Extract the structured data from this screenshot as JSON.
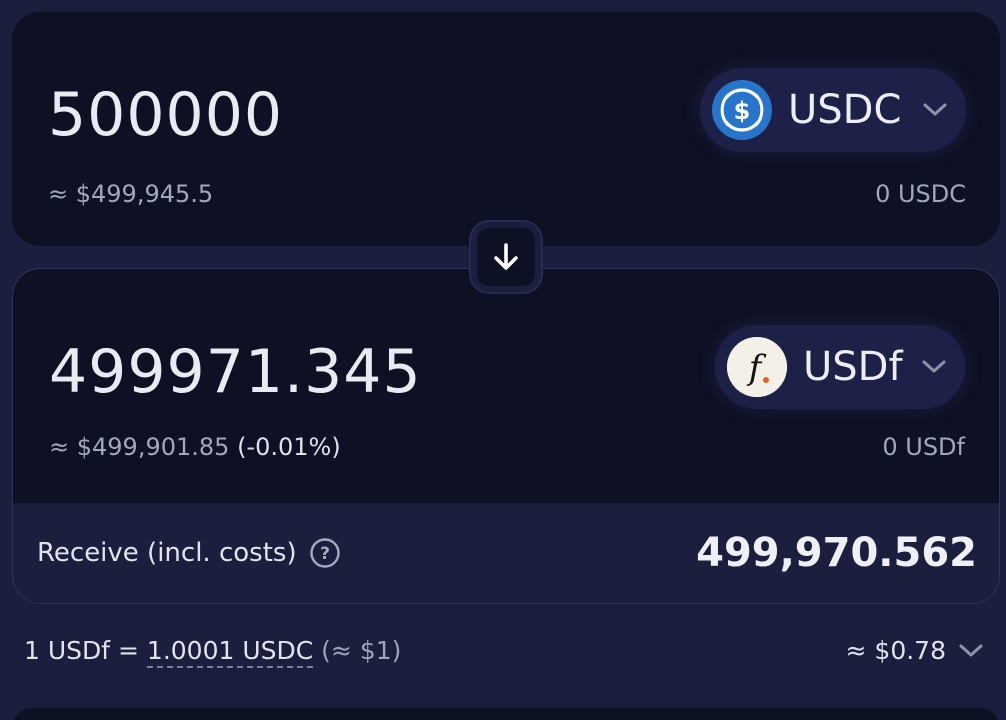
{
  "from": {
    "amount": "500000",
    "usd_value": "≈ $499,945.5",
    "token": "USDC",
    "balance": "0 USDC",
    "logo_color": "#2775ca"
  },
  "to": {
    "amount": "499971.345",
    "usd_value": "≈ $499,901.85",
    "price_impact": "(-0.01%)",
    "token": "USDf",
    "balance": "0 USDf",
    "logo_glyph": "f"
  },
  "receive": {
    "label": "Receive (incl. costs)",
    "value": "499,970.562"
  },
  "rate": {
    "prefix": "1 USDf = ",
    "amount": "1.0001 USDC",
    "usd": " (≈ $1)",
    "gas": "≈ $0.78"
  },
  "icons": {
    "switch": "arrow-down-icon",
    "help": "question-circle-icon",
    "chevron": "chevron-down-icon"
  }
}
